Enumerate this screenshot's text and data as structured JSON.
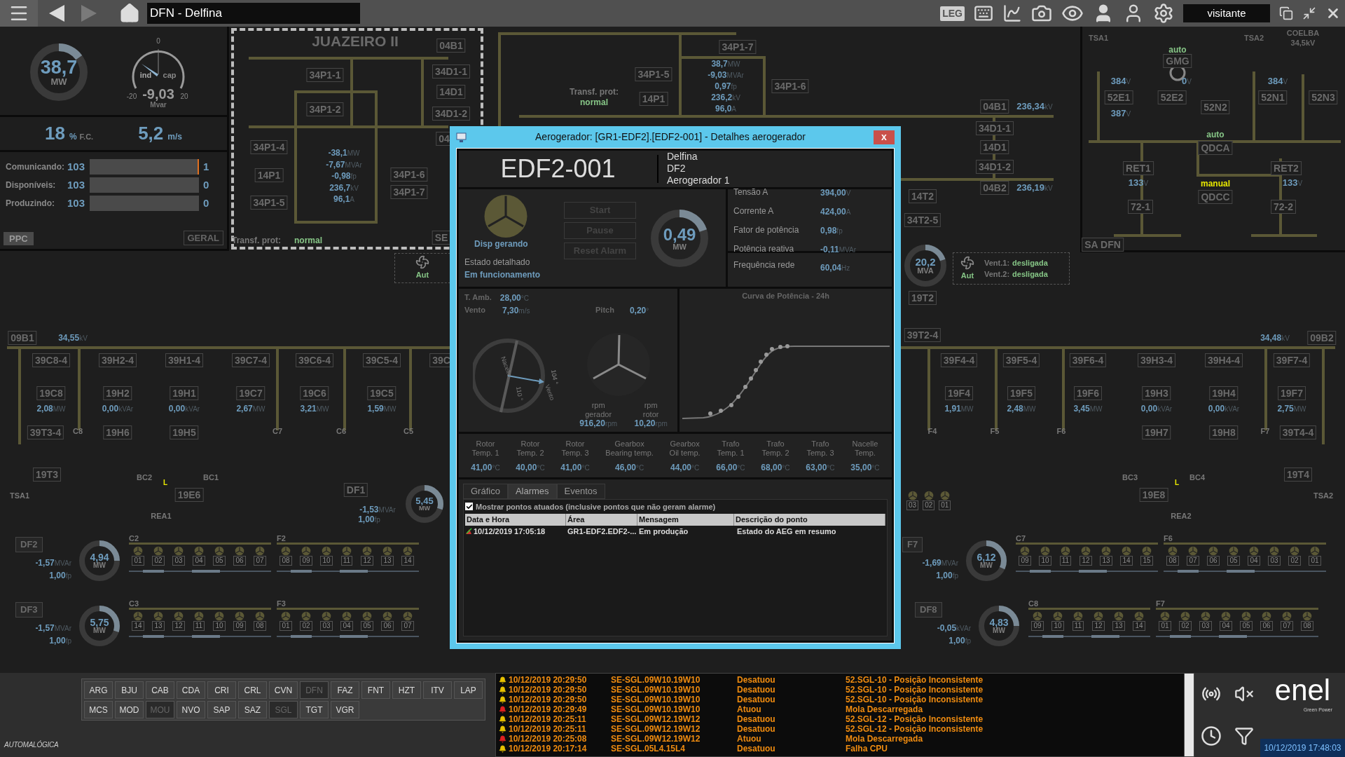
{
  "toolbar": {
    "title": "DFN - Delfina",
    "leg": "LEG",
    "user": "visitante"
  },
  "summary": {
    "power": {
      "v": "38,7",
      "u": "MW",
      "level": 0.15
    },
    "reactive": {
      "v": "-9,03",
      "u": "Mvar",
      "zero": "0",
      "min": "-20",
      "max": "20",
      "ind": "ind",
      "cap": "cap"
    },
    "capacity": {
      "v": "18",
      "u": "%",
      "l": "F.C."
    },
    "wind": {
      "v": "5,2",
      "u": "m/s"
    },
    "counters": [
      {
        "label": "Comunicando:",
        "total": "103",
        "extra": "1",
        "alert": true
      },
      {
        "label": "Disponíveis:",
        "total": "103",
        "extra": "0",
        "alert": false
      },
      {
        "label": "Produzindo:",
        "total": "103",
        "extra": "0",
        "alert": false
      }
    ],
    "buttons": [
      "PPC",
      "GERAL"
    ]
  },
  "juazeiro": {
    "title": "JUAZEIRO II",
    "tags": [
      "04B1",
      "34P1-1",
      "34D1-1",
      "14D1",
      "34P1-2",
      "34D1-2",
      "04",
      "34P1-4",
      "14P1",
      "34P1-5",
      "34P1-6",
      "34P1-7"
    ],
    "readings": [
      {
        "v": "-38,1",
        "u": "MW"
      },
      {
        "v": "-7,67",
        "u": "MVAr"
      },
      {
        "v": "-0,98",
        "u": "fp"
      },
      {
        "v": "236,7",
        "u": "kV"
      },
      {
        "v": "96,1",
        "u": "A"
      }
    ],
    "prot_label": "Transf. prot:",
    "prot_state": "normal",
    "cut": "SE"
  },
  "substation": {
    "tags": [
      "34P1-7",
      "34P1-5",
      "14P1",
      "34P1-6"
    ],
    "readings": [
      {
        "v": "38,7",
        "u": "MW"
      },
      {
        "v": "-9,03",
        "u": "MVAr"
      },
      {
        "v": "0,97",
        "u": "fp"
      },
      {
        "v": "236,2",
        "u": "kV"
      },
      {
        "v": "96,0",
        "u": "A"
      }
    ],
    "prot_label": "Transf. prot:",
    "prot_state": "normal",
    "bars": [
      {
        "tag": "04B1",
        "v": "236,34",
        "u": "kV"
      },
      {
        "tag": "04B2",
        "v": "236,19",
        "u": "kV"
      }
    ],
    "tags2": [
      "34D1-1",
      "14D1",
      "34D1-2",
      "14T2",
      "34T2-5",
      "19T2"
    ],
    "transformer": {
      "v": "20,2",
      "u": "MVA",
      "level": 0.2
    },
    "fan_left": {
      "mode": "Aut"
    },
    "fans": {
      "mode": "Aut",
      "vents": [
        {
          "label": "Vent.1:",
          "state": "desligada"
        },
        {
          "label": "Vent.2:",
          "state": "desligada"
        }
      ]
    }
  },
  "aux": {
    "labels": [
      "TSA1",
      "TSA2",
      "COELBA",
      "34,5kV"
    ],
    "tags": [
      "GMG",
      "52E1",
      "52E2",
      "52N1",
      "52N3",
      "52N2",
      "QDCA",
      "RET1",
      "RET2",
      "QDCC",
      "72-1",
      "72-2",
      "SA DFN"
    ],
    "voltages": [
      {
        "v": "384",
        "u": "V"
      },
      {
        "v": "0",
        "u": "V"
      },
      {
        "v": "384",
        "u": "V"
      },
      {
        "v": "387",
        "u": "V"
      },
      {
        "v": "133",
        "u": "V"
      },
      {
        "v": "133",
        "u": "V"
      }
    ],
    "modes": [
      {
        "text": "auto",
        "kind": "auto"
      },
      {
        "text": "auto",
        "kind": "auto"
      },
      {
        "text": "manual",
        "kind": "manual"
      }
    ]
  },
  "feeders_left": {
    "bus": {
      "tag": "09B1",
      "v": "34,55",
      "u": "kV"
    },
    "columns": [
      {
        "kind": "feeder",
        "top": "39C8-4",
        "breaker": "19C8",
        "v": "2,08",
        "u": "MW",
        "bottom": "C8"
      },
      {
        "kind": "bank",
        "top": "39H2-4",
        "breaker": "19H2",
        "v": "0,00",
        "u": "kVAr",
        "lower": "19H6",
        "bottom": "BC2"
      },
      {
        "kind": "bank",
        "top": "39H1-4",
        "breaker": "19H1",
        "v": "0,00",
        "u": "kVAr",
        "lower": "19H5",
        "bottom": "BC1"
      },
      {
        "kind": "feeder",
        "top": "39C7-4",
        "breaker": "19C7",
        "v": "2,67",
        "u": "MW",
        "bottom": "C7"
      },
      {
        "kind": "feeder",
        "top": "39C6-4",
        "breaker": "19C6",
        "v": "3,21",
        "u": "MW",
        "bottom": "C6"
      },
      {
        "kind": "feeder",
        "top": "39C5-4",
        "breaker": "19C5",
        "v": "1,59",
        "u": "MW",
        "bottom": "C5"
      },
      {
        "kind": "feeder",
        "top": "39C"
      }
    ],
    "aux_tags": [
      "39T3-4",
      "19T3",
      "19E6"
    ],
    "labels": [
      "TSA1",
      "REA1"
    ],
    "marker": "L"
  },
  "feeders_right": {
    "bus": {
      "tag": "09B2",
      "v": "34,48",
      "u": "kV"
    },
    "columns": [
      {
        "kind": "feeder",
        "top": "39F4-4",
        "breaker": "19F4",
        "v": "1,91",
        "u": "MW",
        "bottom": "F4"
      },
      {
        "kind": "feeder",
        "top": "39F5-4",
        "breaker": "19F5",
        "v": "2,48",
        "u": "MW",
        "bottom": "F5"
      },
      {
        "kind": "feeder",
        "top": "39F6-4",
        "breaker": "19F6",
        "v": "3,45",
        "u": "MW",
        "bottom": "F6"
      },
      {
        "kind": "bank",
        "top": "39H3-4",
        "breaker": "19H3",
        "v": "0,00",
        "u": "kVAr",
        "lower": "19H7",
        "bottom": "BC3"
      },
      {
        "kind": "bank",
        "top": "39H4-4",
        "breaker": "19H4",
        "v": "0,00",
        "u": "kVAr",
        "lower": "19H8",
        "bottom": "BC4"
      },
      {
        "kind": "feeder",
        "top": "39F7-4",
        "breaker": "19F7",
        "v": "2,75",
        "u": "MW",
        "bottom": "F7"
      }
    ],
    "aux_tags": [
      "39T4-4",
      "19T4",
      "19E8",
      "39T2-4"
    ],
    "labels": [
      "TSA2",
      "REA2"
    ],
    "marker": "L"
  },
  "df1": {
    "name": "DF1",
    "reactive": {
      "v": "-1,53",
      "u": "MVAr"
    },
    "pf": {
      "v": "1,00",
      "u": "fp"
    },
    "power": {
      "v": "5,45",
      "u": "MW",
      "level": 0.3
    }
  },
  "partial_units": [
    "03",
    "02",
    "01"
  ],
  "farms": [
    {
      "name": "DF2",
      "reactive": {
        "v": "-1,57",
        "u": "MVAr"
      },
      "pf": {
        "v": "1,00",
        "u": "fp"
      },
      "power": {
        "v": "4,94",
        "u": "MW",
        "level": 0.25
      },
      "groups": [
        {
          "feeder": "C2",
          "units": [
            "01",
            "02",
            "03",
            "04",
            "05",
            "06",
            "07"
          ]
        },
        {
          "feeder": "F2",
          "units": [
            "08",
            "09",
            "10",
            "11",
            "12",
            "13",
            "14"
          ]
        }
      ]
    },
    {
      "name": "DF3",
      "reactive": {
        "v": "-1,57",
        "u": "MVAr"
      },
      "pf": {
        "v": "1,00",
        "u": "fp"
      },
      "power": {
        "v": "5,75",
        "u": "MW",
        "level": 0.3
      },
      "groups": [
        {
          "feeder": "C3",
          "units": [
            "14",
            "13",
            "12",
            "11",
            "10",
            "09",
            "08"
          ]
        },
        {
          "feeder": "F3",
          "units": [
            "01",
            "02",
            "03",
            "04",
            "05",
            "06",
            "07"
          ]
        }
      ]
    },
    {
      "name": "F7",
      "reactive": {
        "v": "-1,69",
        "u": "MVAr"
      },
      "pf": {
        "v": "1,00",
        "u": "fp"
      },
      "power": {
        "v": "6,12",
        "u": "MW",
        "level": 0.32
      },
      "groups": [
        {
          "feeder": "C7",
          "units": [
            "09",
            "10",
            "11",
            "12",
            "13",
            "14",
            "15"
          ]
        },
        {
          "feeder": "F6",
          "units": [
            "08",
            "07",
            "06",
            "05",
            "04",
            "03",
            "02",
            "01"
          ]
        }
      ]
    },
    {
      "name": "DF8",
      "reactive": {
        "v": "-0,05",
        "u": "kVAr"
      },
      "pf": {
        "v": "1,00",
        "u": "fp"
      },
      "power": {
        "v": "4,83",
        "u": "MW",
        "level": 0.25
      },
      "groups": [
        {
          "feeder": "C8",
          "units": [
            "09",
            "10",
            "11",
            "12",
            "13",
            "14"
          ]
        },
        {
          "feeder": "F7",
          "units": [
            "01",
            "02",
            "03",
            "04",
            "05",
            "06",
            "07",
            "08"
          ]
        }
      ]
    }
  ],
  "dialog": {
    "title": "Aerogerador: [GR1-EDF2].[EDF2-001] - Detalhes aerogerador",
    "close": "x",
    "name": "EDF2-001",
    "location": [
      "Delfina",
      "DF2",
      "Aerogerador 1"
    ],
    "status": "Disp gerando",
    "detail_label": "Estado detalhado",
    "detail": "Em funcionamento",
    "actions": [
      {
        "label": "Start",
        "disabled": true
      },
      {
        "label": "Pause",
        "disabled": true
      },
      {
        "label": "Reset Alarm",
        "disabled": true
      }
    ],
    "power": {
      "v": "0,49",
      "u": "MW",
      "level": 0.2
    },
    "electrical": [
      {
        "label": "Tensão A",
        "v": "394,00",
        "u": "V"
      },
      {
        "label": "Corrente A",
        "v": "424,00",
        "u": "A"
      },
      {
        "label": "Fator de potência",
        "v": "0,98",
        "u": "fp"
      },
      {
        "label": "Potência reativa",
        "v": "-0,11",
        "u": "MVAr"
      }
    ],
    "frequency": {
      "label": "Frequência rede",
      "v": "60,04",
      "u": "Hz"
    },
    "ambient": [
      {
        "label": "T. Amb.",
        "v": "28,00",
        "u": "°C"
      },
      {
        "label": "Vento",
        "v": "7,30",
        "u": "m/s"
      },
      {
        "label": "Pitch",
        "v": "0,20",
        "u": "°"
      }
    ],
    "compass": {
      "nacelle": "Nacelle",
      "nacelle_angle": "110 °",
      "wind": "Vento",
      "wind_angle": "104 °"
    },
    "rpm": [
      {
        "label": [
          "rpm",
          "gerador"
        ],
        "v": "916,20",
        "u": "rpm"
      },
      {
        "label": [
          "rpm",
          "rotor"
        ],
        "v": "10,20",
        "u": "rpm"
      }
    ],
    "chart_title": "Curva de Potência - 24h",
    "temps": [
      {
        "label": [
          "Rotor",
          "Temp. 1"
        ],
        "v": "41,00",
        "u": "°C"
      },
      {
        "label": [
          "Rotor",
          "Temp. 2"
        ],
        "v": "40,00",
        "u": "°C"
      },
      {
        "label": [
          "Rotor",
          "Temp. 3"
        ],
        "v": "41,00",
        "u": "°C"
      },
      {
        "label": [
          "Gearbox",
          "Bearing temp."
        ],
        "v": "46,00",
        "u": "°C"
      },
      {
        "label": [
          "Gearbox",
          "Oil temp."
        ],
        "v": "44,00",
        "u": "°C"
      },
      {
        "label": [
          "Trafo",
          "Temp. 1"
        ],
        "v": "66,00",
        "u": "°C"
      },
      {
        "label": [
          "Trafo",
          "Temp. 2"
        ],
        "v": "68,00",
        "u": "°C"
      },
      {
        "label": [
          "Trafo",
          "Temp. 3"
        ],
        "v": "63,00",
        "u": "°C"
      },
      {
        "label": [
          "Nacelle",
          "Temp."
        ],
        "v": "35,00",
        "u": "°C"
      }
    ],
    "tabs": [
      {
        "label": "Gráfico",
        "selected": false
      },
      {
        "label": "Alarmes",
        "selected": true
      },
      {
        "label": "Eventos",
        "selected": false
      }
    ],
    "filter": {
      "label": "Mostrar pontos atuados (inclusive pontos que não geram alarme)",
      "checked": true
    },
    "columns": [
      "Data e Hora",
      "Área",
      "Mensagem",
      "Descrição do ponto"
    ],
    "rows": [
      {
        "cells": [
          "10/12/2019 17:05:18",
          "GR1-EDF2.EDF2-...",
          "Em produção",
          "Estado do AEG em resumo"
        ]
      }
    ]
  },
  "sites": [
    {
      "label": "ARG",
      "disabled": false
    },
    {
      "label": "BJU",
      "disabled": false
    },
    {
      "label": "CAB",
      "disabled": false
    },
    {
      "label": "CDA",
      "disabled": false
    },
    {
      "label": "CRI",
      "disabled": false
    },
    {
      "label": "CRL",
      "disabled": false
    },
    {
      "label": "CVN",
      "disabled": false
    },
    {
      "label": "DFN",
      "disabled": true
    },
    {
      "label": "FAZ",
      "disabled": false
    },
    {
      "label": "FNT",
      "disabled": false
    },
    {
      "label": "HZT",
      "disabled": false
    },
    {
      "label": "ITV",
      "disabled": false
    },
    {
      "label": "LAP",
      "disabled": false
    },
    {
      "label": "MCS",
      "disabled": false
    },
    {
      "label": "MOD",
      "disabled": false
    },
    {
      "label": "MOU",
      "disabled": true
    },
    {
      "label": "NVO",
      "disabled": false
    },
    {
      "label": "SAP",
      "disabled": false
    },
    {
      "label": "SAZ",
      "disabled": false
    },
    {
      "label": "SGL",
      "disabled": true
    },
    {
      "label": "TGT",
      "disabled": false
    },
    {
      "label": "VGR",
      "disabled": false
    }
  ],
  "events": [
    {
      "time": "10/12/2019 20:29:50",
      "tag": "SE-SGL.09W10.19W10",
      "action": "Desatuou",
      "desc": "52.SGL-10 - Posição Inconsistente",
      "color": "#e8c200"
    },
    {
      "time": "10/12/2019 20:29:50",
      "tag": "SE-SGL.09W10.19W10",
      "action": "Desatuou",
      "desc": "52.SGL-10 - Posição Inconsistente",
      "color": "#e8c200"
    },
    {
      "time": "10/12/2019 20:29:50",
      "tag": "SE-SGL.09W10.19W10",
      "action": "Desatuou",
      "desc": "52.SGL-10 - Posição Inconsistente",
      "color": "#e8c200"
    },
    {
      "time": "10/12/2019 20:29:49",
      "tag": "SE-SGL.09W10.19W10",
      "action": "Atuou",
      "desc": "Mola Descarregada",
      "color": "#e02020"
    },
    {
      "time": "10/12/2019 20:25:11",
      "tag": "SE-SGL.09W12.19W12",
      "action": "Desatuou",
      "desc": "52.SGL-12 - Posição Inconsistente",
      "color": "#e8c200"
    },
    {
      "time": "10/12/2019 20:25:11",
      "tag": "SE-SGL.09W12.19W12",
      "action": "Desatuou",
      "desc": "52.SGL-12 - Posição Inconsistente",
      "color": "#e8c200"
    },
    {
      "time": "10/12/2019 20:25:08",
      "tag": "SE-SGL.09W12.19W12",
      "action": "Atuou",
      "desc": "Mola Descarregada",
      "color": "#e02020"
    },
    {
      "time": "10/12/2019 20:17:14",
      "tag": "SE-SGL.05L4.15L4",
      "action": "Desatuou",
      "desc": "Falha CPU",
      "color": "#e8c200"
    }
  ],
  "brand": {
    "vendor": "AUTOMALÓGICA",
    "logo": "enel",
    "tagline": "Green Power",
    "clock": "10/12/2019 17:48:03"
  }
}
